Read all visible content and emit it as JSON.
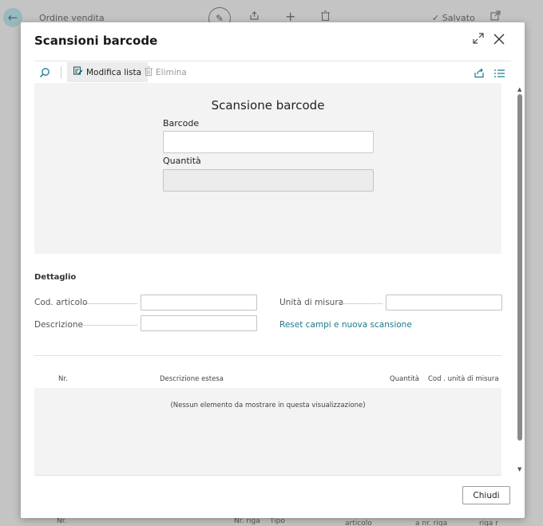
{
  "background": {
    "title": "Ordine vendita",
    "saved_label": "Salvato",
    "bottom_cols": [
      "Nr.",
      "Nr. riga",
      "Tipo",
      "articolo",
      "a nr. riga",
      "riga r"
    ]
  },
  "dialog": {
    "title": "Scansioni barcode",
    "toolbar": {
      "modify_label": "Modifica lista",
      "delete_label": "Elimina"
    },
    "scan": {
      "title": "Scansione barcode",
      "barcode_label": "Barcode",
      "barcode_value": "",
      "quantity_label": "Quantità",
      "quantity_value": ""
    },
    "detail": {
      "section_title": "Dettaglio",
      "item_code_label": "Cod. articolo",
      "item_code_value": "",
      "description_label": "Descrizione",
      "description_value": "",
      "unit_label": "Unità di misura",
      "unit_value": "",
      "reset_link": "Reset campi e nuova scansione"
    },
    "table": {
      "columns": [
        "Nr.",
        "Descrizione estesa",
        "Quantità",
        "Cod . unità di misura"
      ],
      "empty_message": "(Nessun elemento da mostrare in questa visualizzazione)"
    },
    "close_button": "Chiudi"
  }
}
